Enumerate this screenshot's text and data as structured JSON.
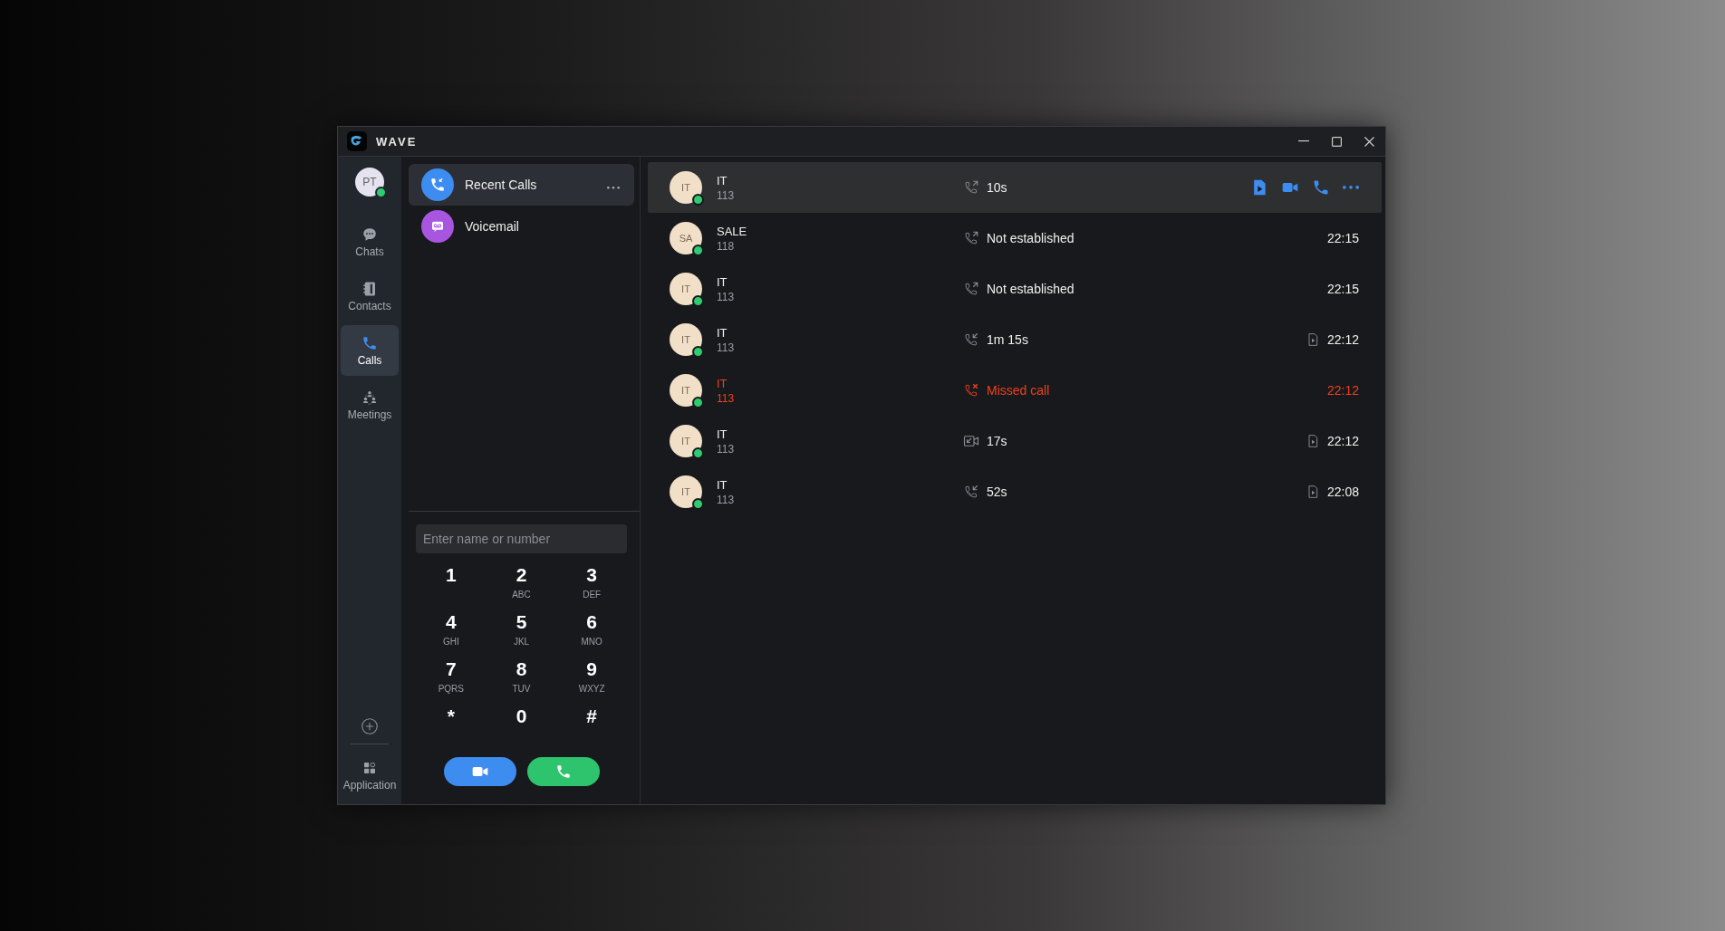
{
  "window": {
    "title": "WAVE"
  },
  "user": {
    "initials": "PT",
    "online": true
  },
  "nav": [
    {
      "label": "Chats",
      "kind": "chats",
      "selected": false
    },
    {
      "label": "Contacts",
      "kind": "contacts",
      "selected": false
    },
    {
      "label": "Calls",
      "kind": "calls",
      "selected": true
    },
    {
      "label": "Meetings",
      "kind": "meetings",
      "selected": false
    }
  ],
  "application": {
    "label": "Application"
  },
  "call_groups": [
    {
      "label": "Recent Calls",
      "kind": "recent",
      "selected": true
    },
    {
      "label": "Voicemail",
      "kind": "voicemail",
      "selected": false
    }
  ],
  "dialer": {
    "placeholder": "Enter name or number",
    "keys": [
      {
        "digit": "1"
      },
      {
        "digit": "2",
        "letters": "ABC"
      },
      {
        "digit": "3",
        "letters": "DEF"
      },
      {
        "digit": "4",
        "letters": "GHI"
      },
      {
        "digit": "5",
        "letters": "JKL"
      },
      {
        "digit": "6",
        "letters": "MNO"
      },
      {
        "digit": "7",
        "letters": "PQRS"
      },
      {
        "digit": "8",
        "letters": "TUV"
      },
      {
        "digit": "9",
        "letters": "WXYZ"
      },
      {
        "digit": "*"
      },
      {
        "digit": "0"
      },
      {
        "digit": "#"
      }
    ]
  },
  "calls": [
    {
      "avatar": "IT",
      "name": "IT",
      "number": "113",
      "online": true,
      "kind": "outgoing",
      "status": "10s",
      "hovered": true
    },
    {
      "avatar": "SA",
      "name": "SALE",
      "number": "118",
      "online": true,
      "kind": "outgoing",
      "status": "Not established",
      "time": "22:15",
      "hovered": false,
      "recording": false
    },
    {
      "avatar": "IT",
      "name": "IT",
      "number": "113",
      "online": true,
      "kind": "outgoing",
      "status": "Not established",
      "time": "22:15",
      "hovered": false,
      "recording": false
    },
    {
      "avatar": "IT",
      "name": "IT",
      "number": "113",
      "online": true,
      "kind": "incoming",
      "status": "1m 15s",
      "time": "22:12",
      "hovered": false,
      "recording": true
    },
    {
      "avatar": "IT",
      "name": "IT",
      "number": "113",
      "online": true,
      "kind": "missed",
      "status": "Missed call",
      "time": "22:12",
      "hovered": false,
      "recording": false
    },
    {
      "avatar": "IT",
      "name": "IT",
      "number": "113",
      "online": true,
      "kind": "video",
      "status": "17s",
      "time": "22:12",
      "hovered": false,
      "recording": true
    },
    {
      "avatar": "IT",
      "name": "IT",
      "number": "113",
      "online": true,
      "kind": "incoming",
      "status": "52s",
      "time": "22:08",
      "hovered": false,
      "recording": true
    }
  ]
}
